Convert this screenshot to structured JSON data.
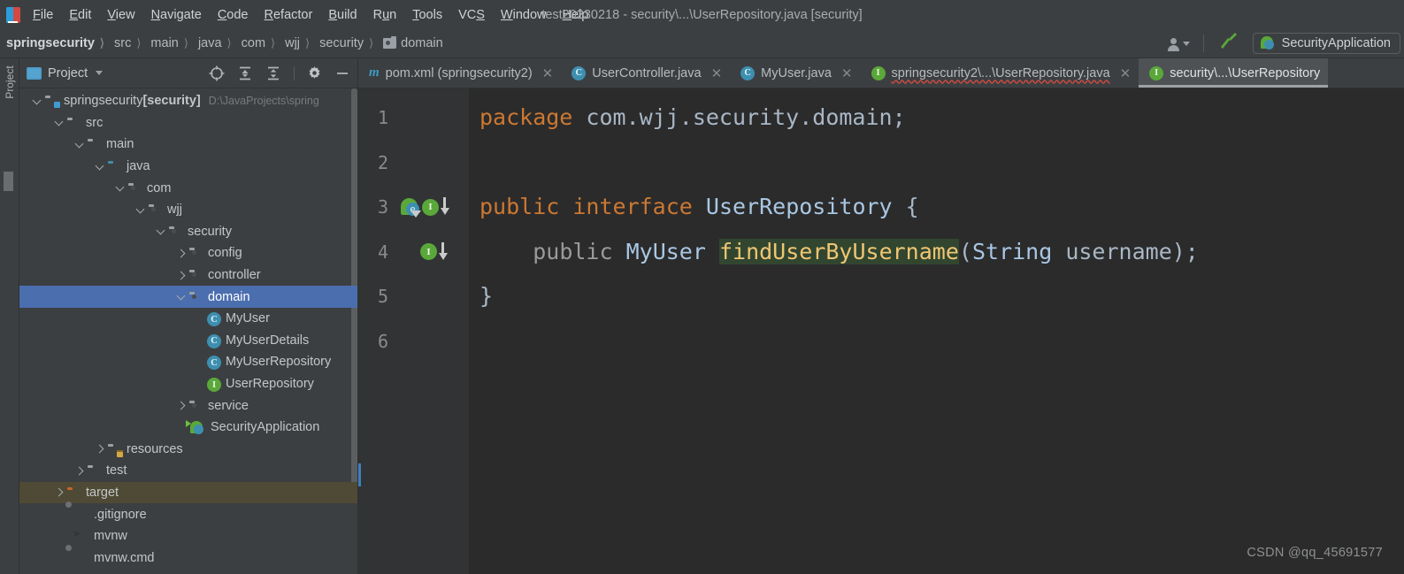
{
  "window": {
    "title": "test20230218 - security\\...\\UserRepository.java [security]"
  },
  "menu": {
    "items": [
      {
        "label": "File",
        "mnemonic": "F"
      },
      {
        "label": "Edit",
        "mnemonic": "E"
      },
      {
        "label": "View",
        "mnemonic": "V"
      },
      {
        "label": "Navigate",
        "mnemonic": "N"
      },
      {
        "label": "Code",
        "mnemonic": "C"
      },
      {
        "label": "Refactor",
        "mnemonic": "R"
      },
      {
        "label": "Build",
        "mnemonic": "B"
      },
      {
        "label": "Run",
        "mnemonic": "n"
      },
      {
        "label": "Tools",
        "mnemonic": "T"
      },
      {
        "label": "VCS",
        "mnemonic": "S"
      },
      {
        "label": "Window",
        "mnemonic": "W"
      },
      {
        "label": "Help",
        "mnemonic": "H"
      }
    ]
  },
  "breadcrumb": {
    "items": [
      {
        "label": "springsecurity",
        "icon": "none",
        "root": true
      },
      {
        "label": "src",
        "icon": "none"
      },
      {
        "label": "main",
        "icon": "none"
      },
      {
        "label": "java",
        "icon": "none"
      },
      {
        "label": "com",
        "icon": "none"
      },
      {
        "label": "wjj",
        "icon": "none"
      },
      {
        "label": "security",
        "icon": "none"
      },
      {
        "label": "domain",
        "icon": "package-icon"
      }
    ],
    "separator": "〉"
  },
  "toolbar_right": {
    "person_icon": "person-icon",
    "build_icon": "hammer-icon",
    "run_config_label": "SecurityApplication",
    "run_config_icon": "spring-boot-icon"
  },
  "tool_window_strip": {
    "label": "Project"
  },
  "project_panel": {
    "title": "Project",
    "window_icon": "project-window-icon",
    "caret_icon": "chevron-down-icon",
    "tools": [
      {
        "name": "locate-icon"
      },
      {
        "name": "expand-all-icon"
      },
      {
        "name": "collapse-all-icon"
      },
      {
        "name": "settings-gear-icon"
      },
      {
        "name": "minimize-icon"
      }
    ],
    "tree": [
      {
        "label": "springsecurity",
        "bold_suffix": " [security]",
        "path": "D:\\JavaProjects\\spring",
        "indent": 0,
        "arrow": "down",
        "icon": "module-folder-icon",
        "state": "normal"
      },
      {
        "label": "src",
        "indent": 1,
        "arrow": "down",
        "icon": "folder-icon",
        "state": "normal"
      },
      {
        "label": "main",
        "indent": 2,
        "arrow": "down",
        "icon": "folder-icon",
        "state": "normal"
      },
      {
        "label": "java",
        "indent": 3,
        "arrow": "down",
        "icon": "source-root-folder-icon",
        "state": "normal"
      },
      {
        "label": "com",
        "indent": 4,
        "arrow": "down",
        "icon": "package-icon",
        "state": "normal"
      },
      {
        "label": "wjj",
        "indent": 5,
        "arrow": "down",
        "icon": "package-icon",
        "state": "normal"
      },
      {
        "label": "security",
        "indent": 6,
        "arrow": "down",
        "icon": "package-icon",
        "state": "normal"
      },
      {
        "label": "config",
        "indent": 7,
        "arrow": "right",
        "icon": "package-icon",
        "state": "normal"
      },
      {
        "label": "controller",
        "indent": 7,
        "arrow": "right",
        "icon": "package-icon",
        "state": "normal"
      },
      {
        "label": "domain",
        "indent": 7,
        "arrow": "down",
        "icon": "package-icon",
        "state": "selected"
      },
      {
        "label": "MyUser",
        "indent": 8,
        "arrow": "none",
        "icon": "class-icon",
        "state": "normal"
      },
      {
        "label": "MyUserDetails",
        "indent": 8,
        "arrow": "none",
        "icon": "class-icon",
        "state": "normal"
      },
      {
        "label": "MyUserRepository",
        "indent": 8,
        "arrow": "none",
        "icon": "class-icon",
        "state": "normal"
      },
      {
        "label": "UserRepository",
        "indent": 8,
        "arrow": "none",
        "icon": "interface-icon",
        "state": "normal"
      },
      {
        "label": "service",
        "indent": 7,
        "arrow": "right",
        "icon": "package-icon",
        "state": "normal"
      },
      {
        "label": "SecurityApplication",
        "indent": 7,
        "arrow": "none",
        "icon": "spring-boot-class-icon",
        "state": "normal"
      },
      {
        "label": "resources",
        "indent": 3,
        "arrow": "right",
        "icon": "resources-folder-icon",
        "state": "normal"
      },
      {
        "label": "test",
        "indent": 2,
        "arrow": "right",
        "icon": "folder-icon",
        "state": "normal"
      },
      {
        "label": "target",
        "indent": 1,
        "arrow": "right",
        "icon": "excluded-folder-icon",
        "state": "hover"
      },
      {
        "label": ".gitignore",
        "indent": 2,
        "arrow": "none",
        "icon": "gitignore-file-icon",
        "state": "normal"
      },
      {
        "label": "mvnw",
        "indent": 2,
        "arrow": "none",
        "icon": "script-file-icon",
        "state": "normal"
      },
      {
        "label": "mvnw.cmd",
        "indent": 2,
        "arrow": "none",
        "icon": "cmd-file-icon",
        "state": "normal"
      }
    ]
  },
  "editor_tabs": [
    {
      "label": "pom.xml (springsecurity2)",
      "icon": "maven-icon",
      "active": false,
      "closable": true,
      "error": false
    },
    {
      "label": "UserController.java",
      "icon": "class-icon",
      "active": false,
      "closable": true,
      "error": false
    },
    {
      "label": "MyUser.java",
      "icon": "class-icon",
      "active": false,
      "closable": true,
      "error": false
    },
    {
      "label": "springsecurity2\\...\\UserRepository.java",
      "icon": "interface-icon",
      "active": false,
      "closable": true,
      "error": true
    },
    {
      "label": "security\\...\\UserRepository",
      "icon": "interface-icon",
      "active": true,
      "closable": false,
      "error": false
    }
  ],
  "editor": {
    "line_numbers": [
      "1",
      "2",
      "3",
      "4",
      "5",
      "6"
    ],
    "gutter_markers": [
      {
        "line": "3",
        "icons": [
          "spring-bean-icon",
          "implemented-interface-icon",
          "down-arrow-icon"
        ]
      },
      {
        "line": "4",
        "icons": [
          "implemented-method-icon",
          "down-arrow-icon"
        ]
      }
    ],
    "lines": [
      {
        "num": "1",
        "tokens": [
          {
            "t": "package",
            "c": "kw"
          },
          {
            "t": " com.wjj.security.domain;",
            "c": "plain"
          }
        ]
      },
      {
        "num": "2",
        "tokens": []
      },
      {
        "num": "3",
        "tokens": [
          {
            "t": "public interface",
            "c": "kw"
          },
          {
            "t": " ",
            "c": "plain"
          },
          {
            "t": "UserRepository",
            "c": "type"
          },
          {
            "t": " {",
            "c": "plain"
          }
        ]
      },
      {
        "num": "4",
        "tokens": [
          {
            "t": "    ",
            "c": "plain"
          },
          {
            "t": "public",
            "c": "dimkw"
          },
          {
            "t": " ",
            "c": "plain"
          },
          {
            "t": "MyUser",
            "c": "type"
          },
          {
            "t": " ",
            "c": "plain"
          },
          {
            "t": "findUserByUsername",
            "c": "hl"
          },
          {
            "t": "(",
            "c": "plain"
          },
          {
            "t": "String",
            "c": "type"
          },
          {
            "t": " username);",
            "c": "plain"
          }
        ]
      },
      {
        "num": "5",
        "tokens": [
          {
            "t": "}",
            "c": "plain"
          }
        ]
      },
      {
        "num": "6",
        "tokens": []
      }
    ]
  },
  "watermark": {
    "text": "CSDN @qq_45691577"
  },
  "colors": {
    "chrome_bg": "#3c3f41",
    "editor_bg": "#2b2b2b",
    "gutter_bg": "#313335",
    "selection_blue": "#4b6eaf",
    "hover_brown": "#4e4a35",
    "keyword_orange": "#cc7832",
    "type_blue": "#a9c7e4",
    "highlight_green": "#32462f",
    "interface_green": "#5aa83a",
    "class_blue": "#3d8fb0"
  }
}
